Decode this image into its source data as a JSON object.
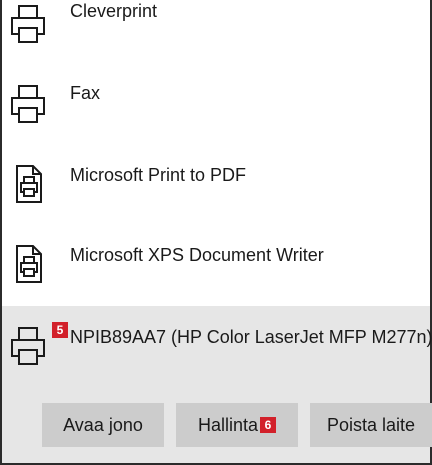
{
  "printers": [
    {
      "name": "Cleverprint",
      "icon": "printer-icon"
    },
    {
      "name": "Fax",
      "icon": "printer-icon"
    },
    {
      "name": "Microsoft Print to PDF",
      "icon": "document-printer-icon"
    },
    {
      "name": "Microsoft XPS Document Writer",
      "icon": "document-printer-icon"
    },
    {
      "name": "NPIB89AA7 (HP Color LaserJet MFP M277n)",
      "icon": "printer-icon",
      "selected": true,
      "badge": "5"
    }
  ],
  "actions": {
    "open_queue_label": "Avaa jono",
    "manage_label": "Hallinta",
    "manage_badge": "6",
    "remove_label": "Poista laite"
  },
  "colors": {
    "selected_bg": "#e6e6e6",
    "button_bg": "#cccccc",
    "badge": "#d2202a"
  }
}
